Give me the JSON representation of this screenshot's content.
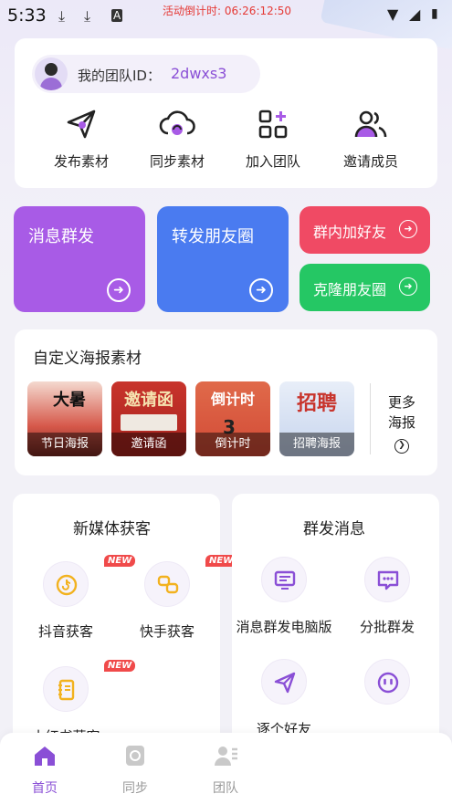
{
  "status_bar": {
    "time": "5:33",
    "countdown": "活动倒计时: 06:26:12:50",
    "icons": [
      "download-icon",
      "download-icon",
      "a-icon",
      "wifi-icon",
      "signal-icon",
      "battery-icon"
    ]
  },
  "team": {
    "label": "我的团队ID：",
    "id": "2dwxs3"
  },
  "quick_actions": [
    {
      "label": "发布素材",
      "icon": "send-icon"
    },
    {
      "label": "同步素材",
      "icon": "cloud-sync-icon"
    },
    {
      "label": "加入团队",
      "icon": "add-grid-icon"
    },
    {
      "label": "邀请成员",
      "icon": "users-icon"
    }
  ],
  "tiles": {
    "mass_message": "消息群发",
    "forward_moments": "转发朋友圈",
    "group_add_friends": "群内加好友",
    "clone_moments": "克隆朋友圈"
  },
  "posters": {
    "title": "自定义海报素材",
    "items": [
      {
        "caption": "节日海报",
        "art": "大暑"
      },
      {
        "caption": "邀请函",
        "art": "邀请函"
      },
      {
        "caption": "倒计时",
        "art": "倒计时"
      },
      {
        "caption": "招聘海报",
        "art": "招聘"
      }
    ],
    "more_line1": "更多",
    "more_line2": "海报"
  },
  "new_media": {
    "title": "新媒体获客",
    "items": [
      {
        "label": "抖音获客",
        "badge": "NEW"
      },
      {
        "label": "快手获客",
        "badge": "NEW"
      },
      {
        "label": "小红书获客",
        "badge": "NEW"
      }
    ]
  },
  "group_message": {
    "title": "群发消息",
    "items": [
      {
        "label": "消息群发电脑版"
      },
      {
        "label": "分批群发"
      },
      {
        "label": "逐个好友"
      },
      {
        "label": ""
      }
    ]
  },
  "tabbar": {
    "items": [
      {
        "label": "首页",
        "active": true
      },
      {
        "label": "同步",
        "active": false
      },
      {
        "label": "团队",
        "active": false
      }
    ]
  },
  "colors": {
    "accent": "#8a4fd6",
    "tile_purple": "#a85be6",
    "tile_blue": "#4a7bf0",
    "pill_red": "#f04a64",
    "pill_green": "#25c764",
    "badge_red": "#f04a4a"
  }
}
